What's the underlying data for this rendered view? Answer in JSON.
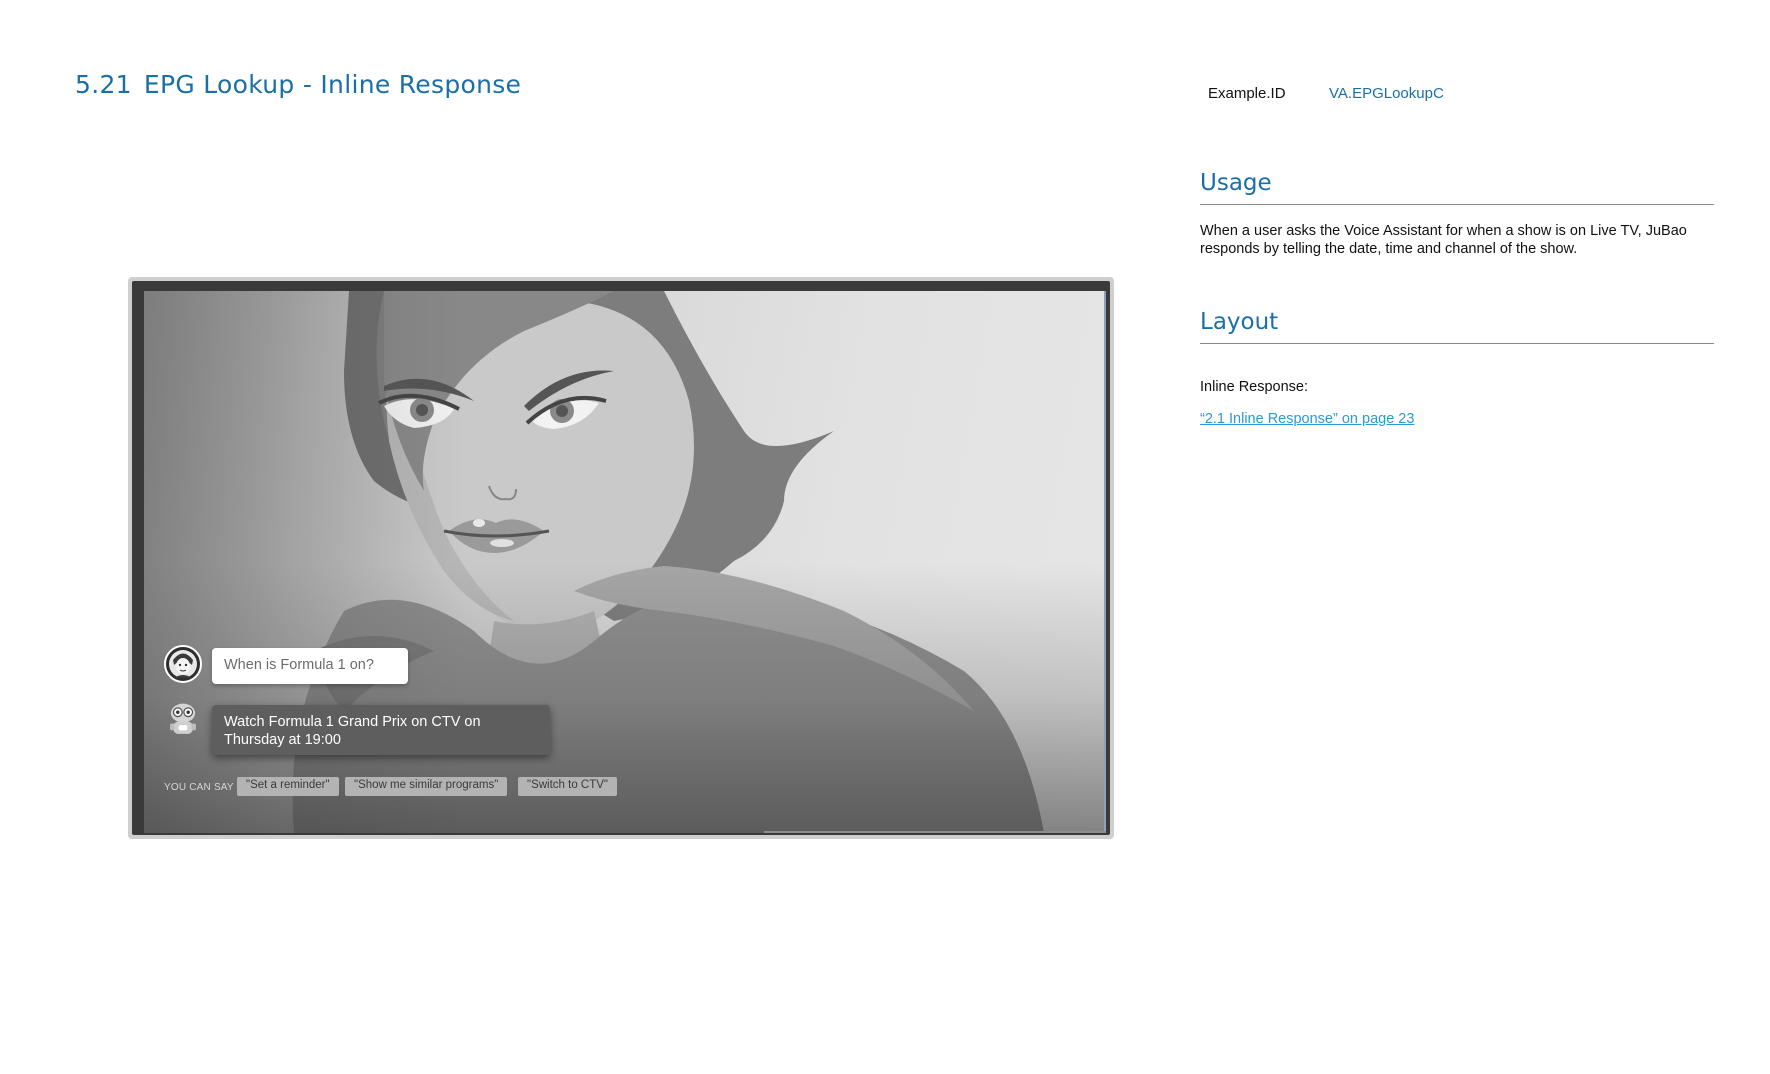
{
  "header": {
    "section_number": "5.21",
    "section_title": "EPG Lookup - Inline Response",
    "example_id_label": "Example.ID",
    "example_id_value": "VA.EPGLookupC"
  },
  "usage": {
    "heading": "Usage",
    "text": "When a user asks the Voice Assistant for when a show is on Live TV, JuBao responds by telling the date, time and channel of the show."
  },
  "layout": {
    "heading": "Layout",
    "label": "Inline Response:",
    "link_text": "“2.1 Inline Response” on page 23"
  },
  "tv": {
    "user_query": "When is Formula 1 on?",
    "assistant_response": "Watch Formula 1 Grand Prix on CTV on Thursday at 19:00",
    "you_can_say_label": "YOU CAN SAY",
    "suggestions": [
      "\"Set a reminder\"",
      "\"Show me similar programs\"",
      "\"Switch to CTV\""
    ],
    "user_avatar_icon": "user-avatar-icon",
    "assistant_avatar_icon": "robot-assistant-icon"
  },
  "colors": {
    "accent": "#1a6fa8",
    "link": "#2a9ad8",
    "response_bubble": "#5e5e5e"
  }
}
